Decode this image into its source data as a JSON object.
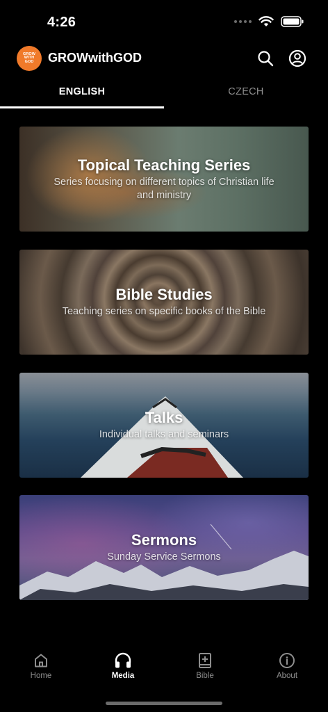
{
  "status_bar": {
    "time": "4:26"
  },
  "header": {
    "logo_text": [
      "GROW",
      "WITH",
      "GOD"
    ],
    "title": "GROWwithGOD",
    "search_icon": "search-icon",
    "profile_icon": "user-circle-icon"
  },
  "tabs": [
    {
      "label": "ENGLISH",
      "selected": true
    },
    {
      "label": "CZECH",
      "selected": false
    }
  ],
  "cards": [
    {
      "title": "Topical Teaching Series",
      "subtitle": "Series focusing on different topics of Christian life and ministry"
    },
    {
      "title": "Bible Studies",
      "subtitle": "Teaching series on specific books of the Bible"
    },
    {
      "title": "Talks",
      "subtitle": "Individual talks and seminars"
    },
    {
      "title": "Sermons",
      "subtitle": "Sunday Service Sermons"
    }
  ],
  "bottom_nav": [
    {
      "label": "Home",
      "icon": "home-icon",
      "active": false
    },
    {
      "label": "Media",
      "icon": "headphones-icon",
      "active": true
    },
    {
      "label": "Bible",
      "icon": "book-plus-icon",
      "active": false
    },
    {
      "label": "About",
      "icon": "info-icon",
      "active": false
    }
  ],
  "colors": {
    "brand": "#f07a2a",
    "background": "#000000",
    "inactive": "#8e8e8e"
  }
}
